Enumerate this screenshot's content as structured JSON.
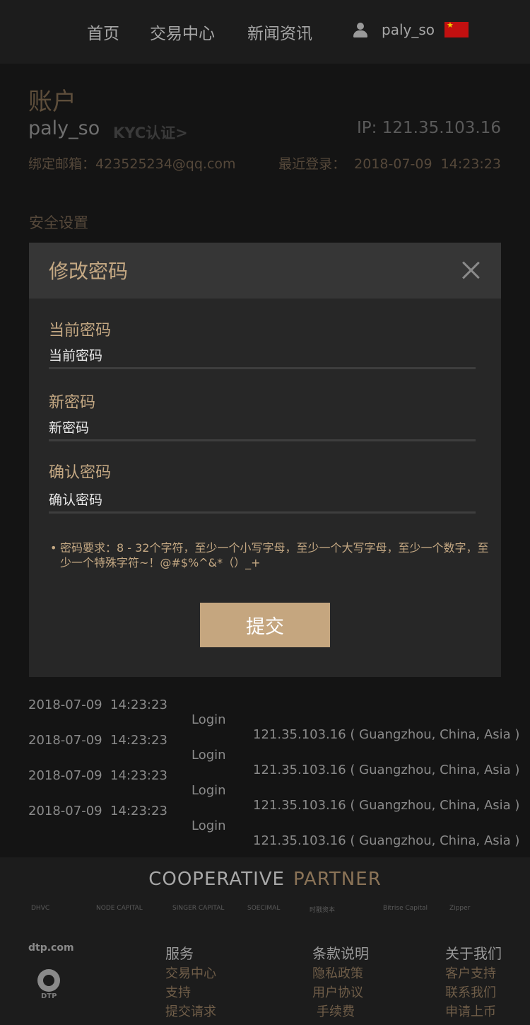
{
  "nav": {
    "items": [
      "首页",
      "交易中心",
      "新闻资讯"
    ],
    "username": "paly_so",
    "flag_icon": "china-flag-icon"
  },
  "account": {
    "title": "账户",
    "username": "paly_so",
    "kyc_link": "KYC认证>",
    "ip": "IP: 121.35.103.16",
    "email": "绑定邮箱：423525234@qq.com",
    "last_login": "最近登录：  2018-07-09  14:23:23",
    "security_title": "安全设置"
  },
  "login_history": [
    {
      "time": "2018-07-09  14:23:23",
      "action": "Login",
      "ip": "121.35.103.16 ( Guangzhou, China, Asia )"
    },
    {
      "time": "2018-07-09  14:23:23",
      "action": "Login",
      "ip": "121.35.103.16 ( Guangzhou, China, Asia )"
    },
    {
      "time": "2018-07-09  14:23:23",
      "action": "Login",
      "ip": "121.35.103.16 ( Guangzhou, China, Asia )"
    },
    {
      "time": "2018-07-09  14:23:23",
      "action": "Login",
      "ip": "121.35.103.16 ( Guangzhou, China, Asia )"
    }
  ],
  "modal": {
    "title": "修改密码",
    "fields": [
      {
        "label": "当前密码",
        "placeholder": "当前密码"
      },
      {
        "label": "新密码",
        "placeholder": "新密码"
      },
      {
        "label": "确认密码",
        "placeholder": "确认密码"
      }
    ],
    "requirement": "密码要求：8 - 32个字符，至少一个小写字母，至少一个大写字母，至少一个数字，至少一个特殊字符~！@#$%^&*（）_+",
    "submit_label": "提交"
  },
  "footer": {
    "coop_a": "COOPERATIVE",
    "coop_b": "PARTNER",
    "partners": [
      "DHVC",
      "NODE CAPITAL",
      "SINGER CAPITAL",
      "SOECIMAL",
      "时戳资本",
      "Bitrise Capital",
      "Zipper"
    ],
    "brand": "dtp.com",
    "logo_label": "DTP",
    "columns": [
      {
        "heading": "服务",
        "links": [
          "交易中心",
          "支持",
          "提交请求"
        ]
      },
      {
        "heading": "条款说明",
        "links": [
          "隐私政策",
          "用户协议",
          "手续费"
        ]
      },
      {
        "heading": "关于我们",
        "links": [
          "客户支持",
          "联系我们",
          "申请上币"
        ]
      }
    ]
  },
  "colors": {
    "accent": "#c5a67f",
    "background": "#141414",
    "modal": "#272727"
  }
}
